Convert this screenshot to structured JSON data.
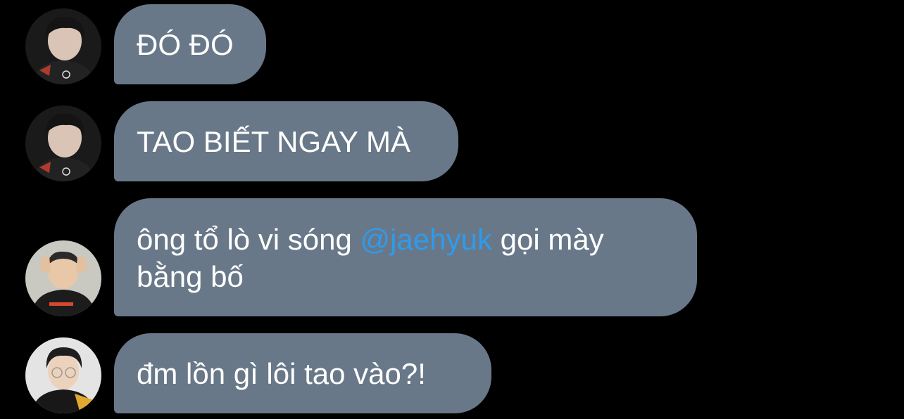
{
  "colors": {
    "background": "#000000",
    "bubble": "#687888",
    "text": "#ffffff",
    "mention": "#2f9bec"
  },
  "messages": [
    {
      "avatar": "avatar-dark-hair-player",
      "text": "ĐÓ ĐÓ"
    },
    {
      "avatar": "avatar-dark-hair-player",
      "text": "TAO BIẾT NGAY MÀ"
    },
    {
      "avatar": "avatar-griffin-player",
      "text_before": "ông tổ lò vi sóng ",
      "mention": "@jaehyuk",
      "text_after": " gọi mày",
      "text_line2": "bằng bố"
    },
    {
      "avatar": "avatar-glasses-player",
      "text": "đm lồn gì lôi tao vào?!"
    }
  ]
}
